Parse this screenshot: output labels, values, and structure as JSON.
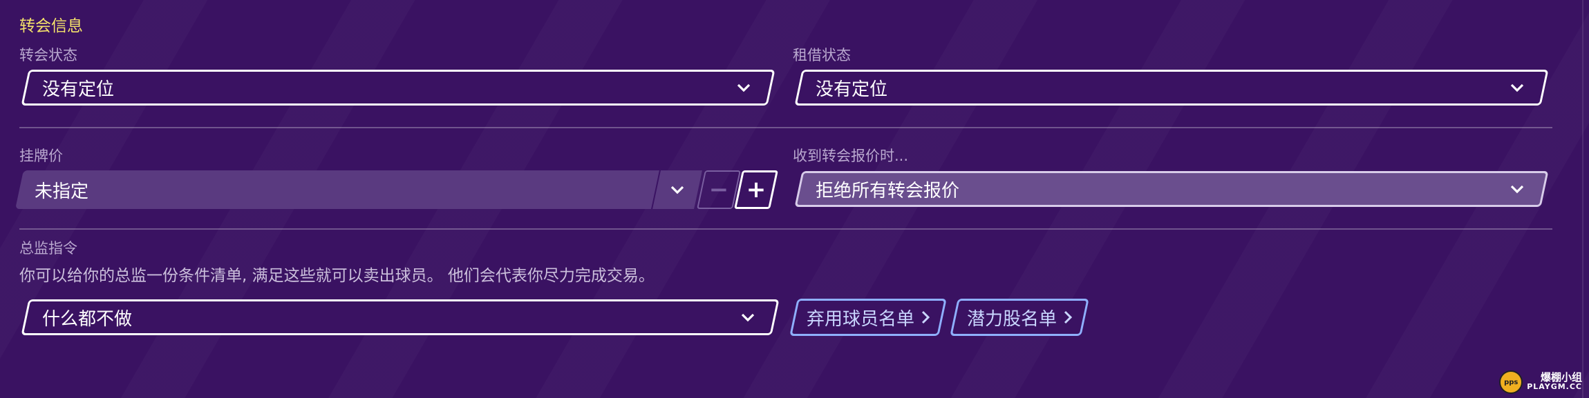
{
  "section_title": "转会信息",
  "transfer_status": {
    "label": "转会状态",
    "value": "没有定位"
  },
  "loan_status": {
    "label": "租借状态",
    "value": "没有定位"
  },
  "list_price": {
    "label": "挂牌价",
    "value": "未指定",
    "minus": "−",
    "plus": "+"
  },
  "offer_response": {
    "label": "收到转会报价时...",
    "value": "拒绝所有转会报价"
  },
  "director": {
    "label": "总监指令",
    "hint": "你可以给你的总监一份条件清单, 满足这些就可以卖出球员。 他们会代表你尽力完成交易。",
    "value": "什么都不做",
    "buttons": [
      "弃用球员名单",
      "潜力股名单"
    ]
  },
  "watermark": {
    "line1": "爆棚小组",
    "line2": "PLAYGM.CC",
    "logo": "pps"
  },
  "colors": {
    "background": "#3a1262",
    "section_title": "#f4e26a",
    "link_button": "#8fb0ff"
  }
}
